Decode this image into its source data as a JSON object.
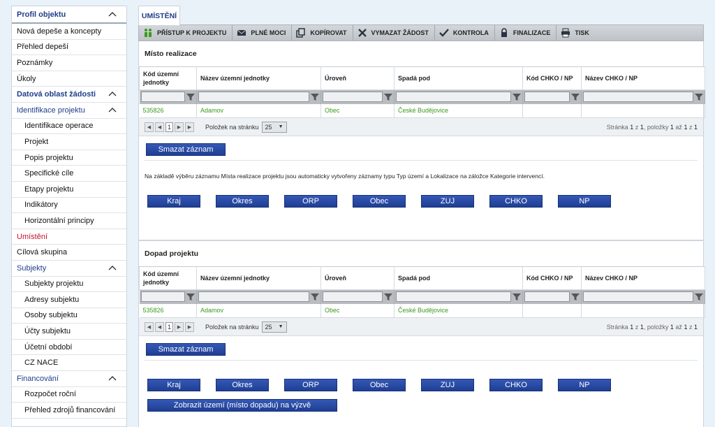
{
  "sidebar": {
    "items": [
      {
        "label": "Profil objektu",
        "kind": "head",
        "expanded": true
      },
      {
        "label": "Nová depeše a koncepty",
        "kind": "item"
      },
      {
        "label": "Přehled depeší",
        "kind": "item"
      },
      {
        "label": "Poznámky",
        "kind": "item"
      },
      {
        "label": "Úkoly",
        "kind": "item"
      },
      {
        "label": "Datová oblast žádosti",
        "kind": "head",
        "expanded": true
      },
      {
        "label": "Identifikace projektu",
        "kind": "group",
        "expanded": true
      },
      {
        "label": "Identifikace operace",
        "kind": "sub"
      },
      {
        "label": "Projekt",
        "kind": "sub"
      },
      {
        "label": "Popis projektu",
        "kind": "sub"
      },
      {
        "label": "Specifické cíle",
        "kind": "sub"
      },
      {
        "label": "Etapy projektu",
        "kind": "sub"
      },
      {
        "label": "Indikátory",
        "kind": "sub"
      },
      {
        "label": "Horizontální principy",
        "kind": "sub"
      },
      {
        "label": "Umístění",
        "kind": "active"
      },
      {
        "label": "Cílová skupina",
        "kind": "item"
      },
      {
        "label": "Subjekty",
        "kind": "group",
        "expanded": true
      },
      {
        "label": "Subjekty projektu",
        "kind": "sub"
      },
      {
        "label": "Adresy subjektu",
        "kind": "sub"
      },
      {
        "label": "Osoby subjektu",
        "kind": "sub"
      },
      {
        "label": "Účty subjektu",
        "kind": "sub"
      },
      {
        "label": "Účetní období",
        "kind": "sub"
      },
      {
        "label": "CZ NACE",
        "kind": "sub"
      },
      {
        "label": "Financování",
        "kind": "group",
        "expanded": true
      },
      {
        "label": "Rozpočet roční",
        "kind": "sub"
      },
      {
        "label": "Přehled zdrojů financování",
        "kind": "sub"
      }
    ]
  },
  "tab": {
    "label": "UMÍSTĚNÍ"
  },
  "toolbar": {
    "buttons": [
      {
        "label": "PŘÍSTUP K PROJEKTU",
        "icon": "users-icon"
      },
      {
        "label": "PLNÉ MOCI",
        "icon": "envelope-icon"
      },
      {
        "label": "KOPÍROVAT",
        "icon": "copy-icon"
      },
      {
        "label": "VYMAZAT ŽÁDOST",
        "icon": "delete-icon"
      },
      {
        "label": "KONTROLA",
        "icon": "check-icon"
      },
      {
        "label": "FINALIZACE",
        "icon": "lock-icon"
      },
      {
        "label": "TISK",
        "icon": "print-icon"
      }
    ]
  },
  "columns": [
    "Kód územní jednotky",
    "Název územní jednotky",
    "Úroveň",
    "Spadá pod",
    "Kód CHKO / NP",
    "Název CHKO / NP"
  ],
  "misto": {
    "title": "Místo realizace",
    "row": [
      "535826",
      "Adamov",
      "Obec",
      "České Budějovice",
      "",
      ""
    ],
    "pager": {
      "page": "1",
      "per_page_label": "Položek na stránku",
      "per_page": "25",
      "info_prefix": "Stránka",
      "info_page": "1",
      "info_of": "z",
      "info_pages": "1",
      "info_items": ", položky",
      "info_from": "1",
      "info_to_word": "až",
      "info_to": "1",
      "info_of2": "z",
      "info_total": "1"
    },
    "delete_label": "Smazat záznam",
    "info": "Na základě výběru záznamu Místa realizace projektu jsou automaticky vytvořeny záznamy typu Typ území a Lokalizace na záložce Kategorie intervencí.",
    "buttons": [
      "Kraj",
      "Okres",
      "ORP",
      "Obec",
      "ZUJ",
      "CHKO",
      "NP"
    ]
  },
  "dopad": {
    "title": "Dopad projektu",
    "row": [
      "535826",
      "Adamov",
      "Obec",
      "České Budějovice",
      "",
      ""
    ],
    "pager": {
      "page": "1",
      "per_page_label": "Položek na stránku",
      "per_page": "25",
      "info_prefix": "Stránka",
      "info_page": "1",
      "info_of": "z",
      "info_pages": "1",
      "info_items": ", položky",
      "info_from": "1",
      "info_to_word": "až",
      "info_to": "1",
      "info_of2": "z",
      "info_total": "1"
    },
    "delete_label": "Smazat záznam",
    "buttons": [
      "Kraj",
      "Okres",
      "ORP",
      "Obec",
      "ZUJ",
      "CHKO",
      "NP"
    ],
    "show_label": "Zobrazit území (místo dopadu) na výzvě"
  },
  "colors": {
    "accent": "#1f3d8a",
    "active": "#c4122f",
    "green": "#3a9a1e",
    "button": "#1e3f94"
  }
}
